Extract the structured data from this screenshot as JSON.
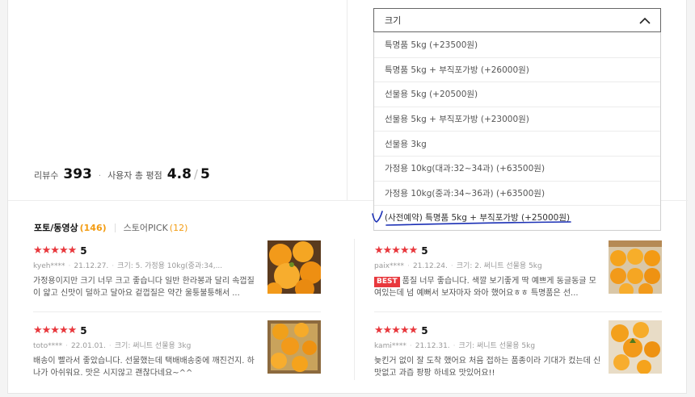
{
  "summary": {
    "review_count_label": "리뷰수",
    "review_count": "393",
    "rating_label": "사용자 총 평점",
    "rating": "4.8",
    "rating_max": "5"
  },
  "tabs": [
    {
      "label": "포토/동영상",
      "count": "(146)"
    },
    {
      "label": "스토어PICK",
      "count": "(12)"
    }
  ],
  "dropdown": {
    "selected": "크기",
    "options": [
      "특명품 5kg (+23500원)",
      "특명품 5kg + 부직포가방 (+26000원)",
      "선물용 5kg (+20500원)",
      "선물용 5kg + 부직포가방 (+23000원)",
      "선물용 3kg",
      "가정용 10kg(대과:32~34과) (+63500원)",
      "가정용 10kg(중과:34~36과) (+63500원)",
      "(사전예약) 특명품 5kg + 부직포가방 (+25000원)"
    ]
  },
  "reviews": [
    {
      "score": "5",
      "user": "kyeh****",
      "date": "21.12.27.",
      "option": "크기: 5. 가정용 10kg(중과:34,...",
      "badge": "",
      "text": "가정용이지만 크기 너무 크고 좋습니다 일반 한라봉과 달리 속껍질이 얇고 신맛이 덜하고 달아요 겉껍질은 약간 울퉁불퉁해서 ..."
    },
    {
      "score": "5",
      "user": "paix****",
      "date": "21.12.24.",
      "option": "크기: 2. 써니트 선물용 5kg",
      "badge": "BEST",
      "text": "품질 너무 좋습니다. 색깔 보기좋게 딱 예쁘게 동글동글 모여있는데 넘 예뻐서 보자마자 와아 했어요ㅎㅎ 특명품은 선..."
    },
    {
      "score": "5",
      "user": "toto****",
      "date": "22.01.01.",
      "option": "크기: 써니트 선물용 3kg",
      "badge": "",
      "text": "배송이 빨라서 좋았습니다. 선물했는데 택배배송중에 깨진건지. 하나가 아쉬워요. 맛은 시지않고 괜찮다네요~^^"
    },
    {
      "score": "5",
      "user": "kami****",
      "date": "21.12.31.",
      "option": "크기: 써니트 선물용 5kg",
      "badge": "",
      "text": "늦킨거 없이 잘 도착 했어요 처음 접하는 품종이라 기대가 컸는데 신맛없고 과즙 팡팡 하네요 맛있어요!!"
    }
  ],
  "colors": {
    "star": "#e8383d",
    "count": "#f39c12",
    "badge": "#e8383d",
    "annotation": "#1a2fb5"
  }
}
